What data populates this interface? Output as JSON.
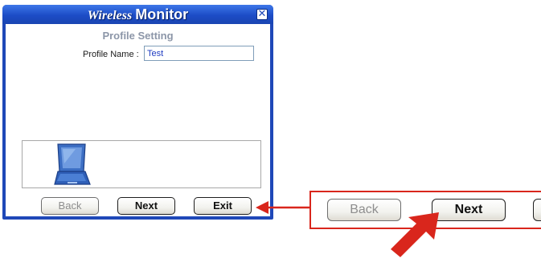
{
  "window": {
    "title_italic": "Wireless",
    "title_bold": "Monitor",
    "close_glyph": "✕",
    "heading": "Profile Setting",
    "profile_name_label": "Profile Name :",
    "profile_name_value": "Test",
    "image_icon": "laptop-icon"
  },
  "buttons": {
    "back": "Back",
    "next": "Next",
    "exit": "Exit"
  },
  "zoom": {
    "back": "Back",
    "next": "Next",
    "exit": ""
  },
  "colors": {
    "title_bar": "#1f48b8",
    "callout": "#d9261c",
    "input_text": "#1f3cc2"
  }
}
